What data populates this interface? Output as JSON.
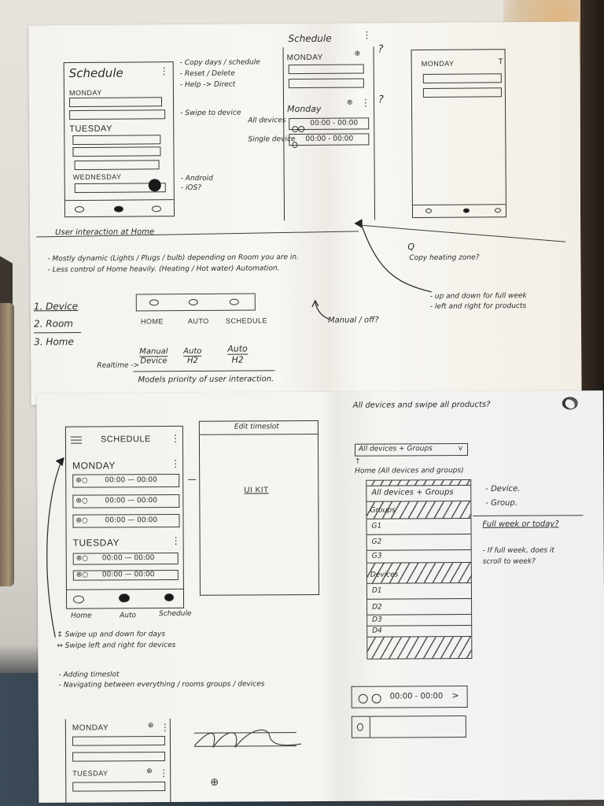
{
  "photo": {
    "subject": "Hand-drawn wireframe sketches for a heating schedule mobile app on two sheets of paper"
  },
  "sheet_top": {
    "sketch_schedule_a": {
      "title": "Schedule",
      "menu_icon": "kebab-menu-icon",
      "days": [
        "MONDAY",
        "TUESDAY",
        "WEDNESDAY"
      ],
      "bottom_nav_icons": [
        "circle",
        "filled-circle",
        "circle"
      ],
      "fab_icon": "filled-circle-fab",
      "annotations": [
        "- Copy days / schedule",
        "- Reset / Delete",
        "- Help -> Direct",
        "- Swipe to device"
      ],
      "platform_notes": [
        "- Android",
        "- iOS?"
      ]
    },
    "sketch_schedule_b": {
      "title": "Schedule",
      "sections": [
        {
          "day": "MONDAY",
          "add_icon": "plus-circle-icon"
        },
        {
          "day": "Monday",
          "add_icon": "plus-circle-icon",
          "menu_icon": "kebab-menu-icon"
        }
      ],
      "rows": [
        {
          "label": "All devices",
          "icons": 2,
          "time": "00:00 - 00:00"
        },
        {
          "label": "Single device",
          "icons": 1,
          "time": "00:00 - 00:00"
        }
      ],
      "question_marks": [
        "?",
        "?"
      ]
    },
    "sketch_schedule_c": {
      "day": "MONDAY",
      "peek_label": "T"
    },
    "notes": {
      "heading": "User interaction at Home",
      "lines": [
        "- Mostly dynamic (Lights / Plugs / bulb) depending on Room you are in.",
        "- Less control of Home heavily. (Heating / Hot water) Automation."
      ],
      "priority_list": [
        "1. Device",
        "2. Room",
        "3. Home"
      ],
      "nav_bar_labels": [
        "HOME",
        "AUTO",
        "SCHEDULE"
      ],
      "manual_off_note": "Manual / off?",
      "realtime_label": "Realtime ->",
      "priority_fractions": [
        {
          "top": "Manual",
          "bottom": "Device"
        },
        {
          "top": "Auto",
          "bottom": "H2"
        },
        {
          "top": "Auto",
          "bottom": "H2"
        }
      ],
      "priority_caption": "Models priority of user interaction.",
      "question_q": "Q",
      "copy_heating": "Copy heating zone?",
      "swipe_notes": [
        "- up and down for full week",
        "- left and right for products"
      ]
    }
  },
  "sheet_bottom": {
    "sketch_schedule_main": {
      "title": "SCHEDULE",
      "hamburger_icon": "hamburger-menu-icon",
      "kebab_icon": "kebab-menu-icon",
      "days": [
        {
          "name": "MONDAY",
          "slots": [
            "00:00 — 00:00",
            "00:00 — 00:00",
            "00:00 — 00:00"
          ]
        },
        {
          "name": "TUESDAY",
          "slots": [
            "00:00 — 00:00",
            "00:00 — 00:00"
          ]
        }
      ],
      "bottom_nav": [
        "Home",
        "Auto",
        "Schedule"
      ]
    },
    "sketch_edit_timeslot": {
      "title": "Edit timeslot",
      "body": "UI KIT"
    },
    "notes_left": [
      "↕ Swipe up and down for days",
      "↔ Swipe left and right for devices",
      "- Adding timeslot",
      "- Navigating between everything / rooms groups / devices"
    ],
    "sketch_schedule_small": {
      "days": [
        "MONDAY",
        "TUESDAY"
      ],
      "add_icon": "plus-circle-icon",
      "fab_icon": "plus-circle-icon"
    },
    "devices_panel": {
      "question": "All devices and swipe all products?",
      "dropdown_value": "All devices + Groups",
      "dropdown_chevron": "v",
      "dropdown_caption": "Home (All devices and groups)",
      "list_items": [
        {
          "label": "All devices + Groups",
          "type": "item"
        },
        {
          "label": "Groups",
          "type": "header"
        },
        {
          "label": "G1",
          "type": "item"
        },
        {
          "label": "G2",
          "type": "item"
        },
        {
          "label": "G3",
          "type": "item"
        },
        {
          "label": "Devices",
          "type": "header"
        },
        {
          "label": "D1",
          "type": "item"
        },
        {
          "label": "D2",
          "type": "item"
        },
        {
          "label": "D3",
          "type": "item"
        },
        {
          "label": "D4",
          "type": "item"
        }
      ],
      "side_notes": [
        "- Device.",
        "- Group."
      ],
      "question_week": "Full week or today?",
      "question_scroll": "- If full week, does it scroll to week?",
      "timeslot_row": {
        "time": "00:00 - 00:00",
        "chevron": ">"
      }
    }
  }
}
